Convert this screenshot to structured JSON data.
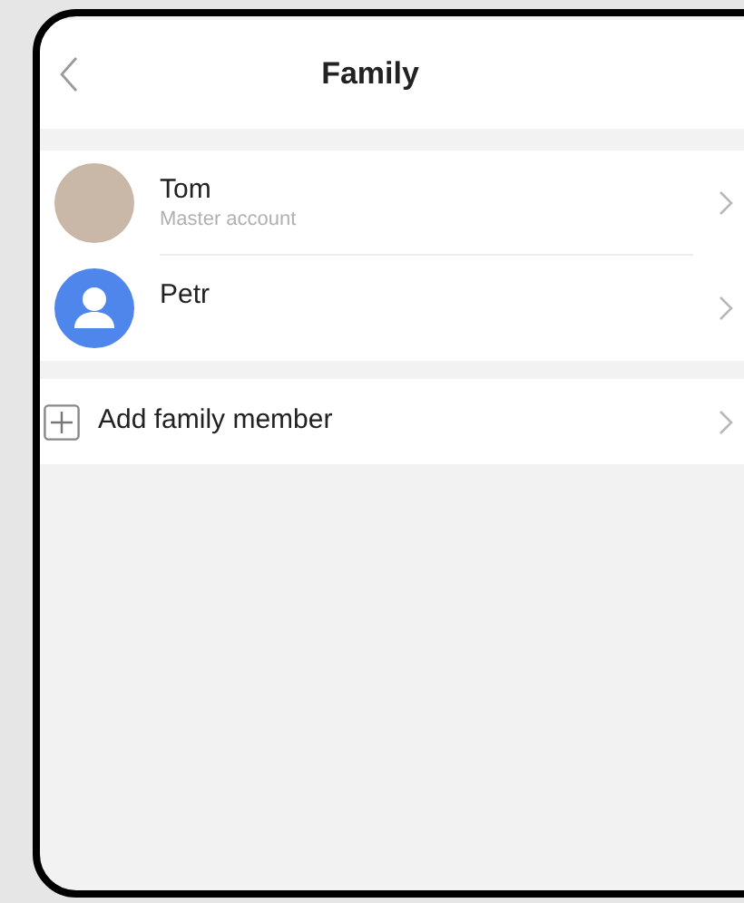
{
  "nav": {
    "title": "Family"
  },
  "members": [
    {
      "name": "Tom",
      "subtitle": "Master account",
      "kind": "photo"
    },
    {
      "name": "Petr",
      "kind": "default"
    }
  ],
  "add_row": {
    "label": "Add family member"
  }
}
